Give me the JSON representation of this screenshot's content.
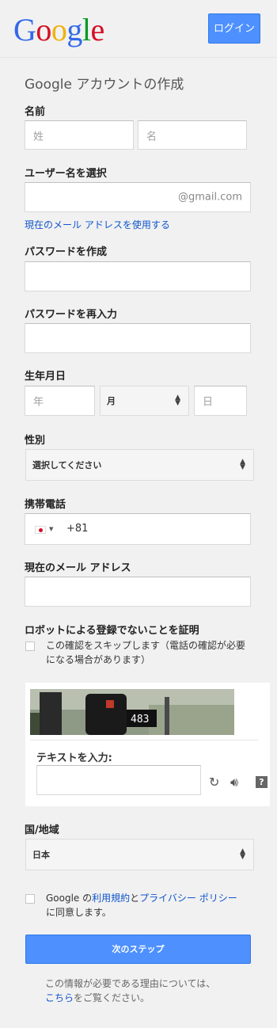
{
  "header": {
    "logo_letters": [
      "G",
      "o",
      "o",
      "g",
      "l",
      "e"
    ],
    "logo_colors": [
      "#3369e8",
      "#d50f25",
      "#eeb211",
      "#3369e8",
      "#009925",
      "#d50f25"
    ],
    "login_label": "ログイン"
  },
  "form": {
    "title": "Google アカウントの作成",
    "name_label": "名前",
    "last_name_placeholder": "姓",
    "first_name_placeholder": "名",
    "username_label": "ユーザー名を選択",
    "username_suffix": "@gmail.com",
    "use_current_email_link": "現在のメール アドレスを使用する",
    "password_label": "パスワードを作成",
    "password_confirm_label": "パスワードを再入力",
    "birthday_label": "生年月日",
    "year_placeholder": "年",
    "month_value": "月",
    "day_placeholder": "日",
    "gender_label": "性別",
    "gender_value": "選択してください",
    "phone_label": "携帯電話",
    "phone_prefix": "+81",
    "current_email_label": "現在のメール アドレス",
    "robot_label": "ロボットによる登録でないことを証明",
    "skip_verification_text": "この確認をスキップします（電話の確認が必要になる場合があります）",
    "captcha_number": "483",
    "captcha_input_label": "テキストを入力:",
    "captcha_help": "?",
    "country_label": "国/地域",
    "country_value": "日本",
    "terms_prefix": "Google の",
    "terms_link": "利用規約",
    "terms_and": "と",
    "privacy_link": "プライバシー ポリシー",
    "terms_suffix": "に同意します。",
    "next_button": "次のステップ",
    "footer_text": "この情報が必要である理由については、",
    "footer_link": "こちら",
    "footer_suffix": "をご覧ください。"
  },
  "colors": {
    "accent": "#4d90fe",
    "link": "#1155cc"
  }
}
